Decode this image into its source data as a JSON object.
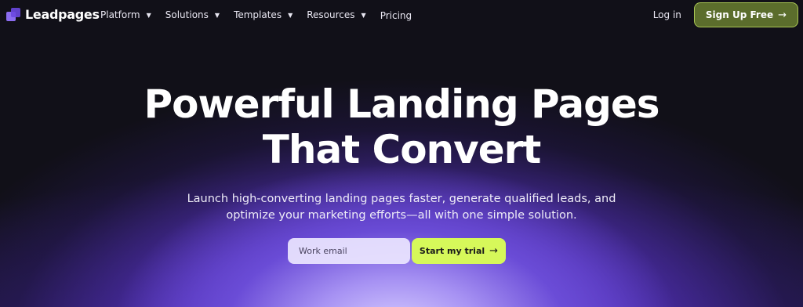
{
  "brand": {
    "name": "Leadpages"
  },
  "nav": {
    "items": [
      {
        "label": "Platform",
        "has_dropdown": true
      },
      {
        "label": "Solutions",
        "has_dropdown": true
      },
      {
        "label": "Templates",
        "has_dropdown": true
      },
      {
        "label": "Resources",
        "has_dropdown": true
      },
      {
        "label": "Pricing",
        "has_dropdown": false
      }
    ],
    "login_label": "Log in",
    "signup_label": "Sign Up Free",
    "chevron_glyph": "▼",
    "arrow_glyph": "→"
  },
  "hero": {
    "title_line1": "Powerful Landing Pages",
    "title_line2": "That Convert",
    "subtitle_line1": "Launch high-converting landing pages faster, generate qualified leads, and",
    "subtitle_line2": "optimize your marketing efforts—all with one simple solution.",
    "email_placeholder": "Work email",
    "cta_label": "Start my trial"
  },
  "colors": {
    "background": "#111018",
    "accent_purple": "#7a55e6",
    "signup_bg": "#5b6d2c",
    "signup_border": "#a9c654",
    "cta_bg": "#d6f85a"
  }
}
